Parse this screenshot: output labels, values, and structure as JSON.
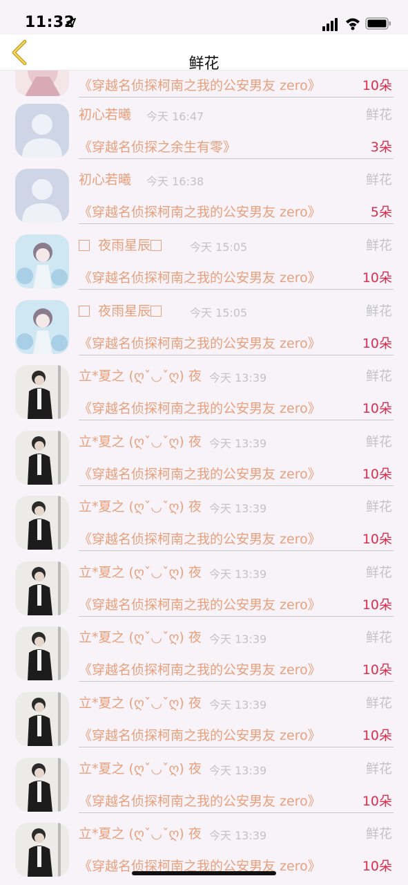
{
  "status_bar": {
    "time": "11:32"
  },
  "nav": {
    "title": "鲜花"
  },
  "rows": [
    {
      "user": "",
      "time": "",
      "type": "",
      "book": "《穿越名侦探柯南之我的公安男友 zero》",
      "count": "10朵",
      "avatar": "pink-girl"
    },
    {
      "user": "初心若曦",
      "time": "今天 16:47",
      "type": "鲜花",
      "book": "《穿越名侦探之余生有零》",
      "count": "3朵",
      "avatar": "default"
    },
    {
      "user": "初心若曦",
      "time": "今天 16:38",
      "type": "鲜花",
      "book": "《穿越名侦探柯南之我的公安男友 zero》",
      "count": "5朵",
      "avatar": "default"
    },
    {
      "user": "夜雨星辰",
      "time": "今天 15:05",
      "type": "鲜花",
      "book": "《穿越名侦探柯南之我的公安男友 zero》",
      "count": "10朵",
      "avatar": "blue-girl"
    },
    {
      "user": "夜雨星辰",
      "time": "今天 15:05",
      "type": "鲜花",
      "book": "《穿越名侦探柯南之我的公安男友 zero》",
      "count": "10朵",
      "avatar": "blue-girl"
    },
    {
      "user": "立*夏之 (ღˇ◡ˇღ) 夜",
      "time": "今天 13:39",
      "type": "鲜花",
      "book": "《穿越名侦探柯南之我的公安男友 zero》",
      "count": "10朵",
      "avatar": "dark-boy"
    },
    {
      "user": "立*夏之 (ღˇ◡ˇღ) 夜",
      "time": "今天 13:39",
      "type": "鲜花",
      "book": "《穿越名侦探柯南之我的公安男友 zero》",
      "count": "10朵",
      "avatar": "dark-boy"
    },
    {
      "user": "立*夏之 (ღˇ◡ˇღ) 夜",
      "time": "今天 13:39",
      "type": "鲜花",
      "book": "《穿越名侦探柯南之我的公安男友 zero》",
      "count": "10朵",
      "avatar": "dark-boy"
    },
    {
      "user": "立*夏之 (ღˇ◡ˇღ) 夜",
      "time": "今天 13:39",
      "type": "鲜花",
      "book": "《穿越名侦探柯南之我的公安男友 zero》",
      "count": "10朵",
      "avatar": "dark-boy"
    },
    {
      "user": "立*夏之 (ღˇ◡ˇღ) 夜",
      "time": "今天 13:39",
      "type": "鲜花",
      "book": "《穿越名侦探柯南之我的公安男友 zero》",
      "count": "10朵",
      "avatar": "dark-boy"
    },
    {
      "user": "立*夏之 (ღˇ◡ˇღ) 夜",
      "time": "今天 13:39",
      "type": "鲜花",
      "book": "《穿越名侦探柯南之我的公安男友 zero》",
      "count": "10朵",
      "avatar": "dark-boy"
    },
    {
      "user": "立*夏之 (ღˇ◡ˇღ) 夜",
      "time": "今天 13:39",
      "type": "鲜花",
      "book": "《穿越名侦探柯南之我的公安男友 zero》",
      "count": "10朵",
      "avatar": "dark-boy"
    },
    {
      "user": "立*夏之 (ღˇ◡ˇღ) 夜",
      "time": "今天 13:39",
      "type": "鲜花",
      "book": "《穿越名侦探柯南之我的公安男友 zero》",
      "count": "10朵",
      "avatar": "dark-boy"
    }
  ],
  "colors": {
    "name": "#e8a07c",
    "count": "#d92e4e",
    "muted": "#c3c3c3",
    "back": "#c9a227"
  }
}
